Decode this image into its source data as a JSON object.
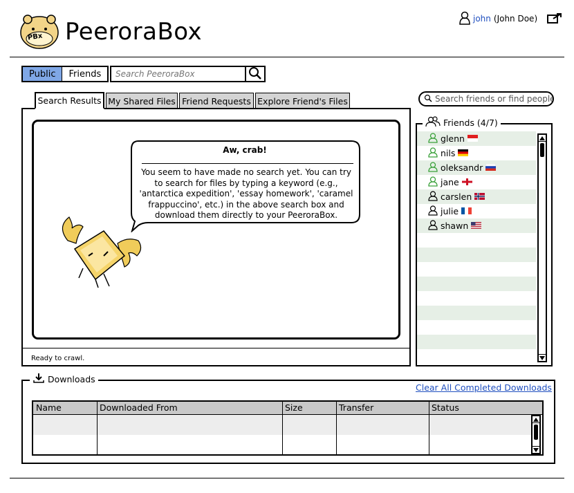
{
  "header": {
    "app_title": "PeeroraBox",
    "logo_text": "PBx",
    "user_name": "john",
    "user_fullname": "(John Doe)"
  },
  "search": {
    "scopes": [
      "Public",
      "Friends"
    ],
    "active_scope": "Public",
    "placeholder": "Search PeeroraBox"
  },
  "tabs": [
    {
      "label": "Search Results"
    },
    {
      "label": "My Shared Files"
    },
    {
      "label": "Friend Requests"
    },
    {
      "label": "Explore Friend's Files"
    }
  ],
  "message": {
    "title": "Aw, crab!",
    "lines": [
      "You seem to have made no search yet. You can try",
      "to search for files by typing a keyword (e.g.,",
      "'antarctica expedition', 'essay homework', 'caramel",
      "frappuccino', etc.) in the above search box and",
      "download them directly to your PeeroraBox."
    ]
  },
  "status": "Ready to crawl.",
  "friends": {
    "search_placeholder": "Search friends or find people",
    "legend": "Friends (4/7)",
    "items": [
      {
        "name": "glenn",
        "online": true,
        "flag": "indonesia"
      },
      {
        "name": "nils",
        "online": true,
        "flag": "germany"
      },
      {
        "name": "oleksandr",
        "online": true,
        "flag": "russia"
      },
      {
        "name": "jane",
        "online": true,
        "flag": "england"
      },
      {
        "name": "carslen",
        "online": false,
        "flag": "norway"
      },
      {
        "name": "julie",
        "online": false,
        "flag": "france"
      },
      {
        "name": "shawn",
        "online": false,
        "flag": "usa"
      }
    ]
  },
  "downloads": {
    "legend": "Downloads",
    "clear_label": "Clear All Completed Downloads",
    "columns": [
      "Name",
      "Downloaded From",
      "Size",
      "Transfer",
      "Status"
    ]
  },
  "colors": {
    "scope_active": "#7fa7e6",
    "online": "#3aa13a",
    "link": "#1f4fbf",
    "row_alt": "#e6efe6"
  }
}
